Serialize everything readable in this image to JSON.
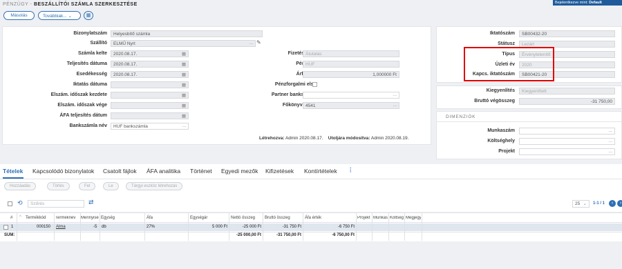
{
  "header": {
    "breadcrumb": "PÉNZÜGY",
    "title": "BESZÁLLÍTÓI SZÁMLA SZERKESZTÉSE",
    "login_text": "Bejelentkezve mint: ",
    "login_user": "Default"
  },
  "toolbar": {
    "copy": "Másolás",
    "more": "Továbbiak..."
  },
  "left": {
    "bizonylatszam": {
      "label": "Bizonylatszám",
      "value": "Helyesbítő számla"
    },
    "szallito": {
      "label": "Szállító",
      "value": "ELMŰ Nyrt"
    },
    "szamla_kelte": {
      "label": "Számla kelte",
      "value": "2020.08.17."
    },
    "teljesites": {
      "label": "Teljesítés dátuma",
      "value": "2020.08.17."
    },
    "esedekesseg": {
      "label": "Esedékesség",
      "value": "2020.08.17."
    },
    "iktatas": {
      "label": "Iktatás dátuma",
      "value": ""
    },
    "idoszak_kezdete": {
      "label": "Elszám. időszak kezdete",
      "value": ""
    },
    "idoszak_vege": {
      "label": "Elszám. időszak vége",
      "value": ""
    },
    "afa_teljesites": {
      "label": "ÁFA teljesítés dátum",
      "value": ""
    },
    "bankszamla": {
      "label": "Bankszámla név",
      "value": "HUF bankszámla"
    }
  },
  "mid": {
    "fizetesi_mod": {
      "label": "Fizetési mód",
      "value": "Átutalás"
    },
    "penznem": {
      "label": "Pénznem",
      "value": "HUF"
    },
    "arfolyam": {
      "label": "Árfolyam",
      "value": "1,000000 Ft"
    },
    "penzforgalmi": {
      "label": "Pénzforgalmi elsz."
    },
    "partner_bank": {
      "label": "Partner bankszámla",
      "value": ""
    },
    "fokonyvi": {
      "label": "Főkönyvi szám",
      "value": "4541"
    }
  },
  "footer": {
    "created_label": "Létrehozva:",
    "created_value": "Admin 2020.08.17.",
    "modified_label": "Utoljára módosítva:",
    "modified_value": "Admin 2020.08.19."
  },
  "right": {
    "iktatoszam": {
      "label": "Iktatószám",
      "value": "SB00432-20"
    },
    "statusz": {
      "label": "Státusz",
      "value": "Lezárt"
    },
    "tipus": {
      "label": "Típus",
      "value": "Érvénytelenítő"
    },
    "uzleti_ev": {
      "label": "Üzleti év",
      "value": "2020"
    },
    "kapcs": {
      "label": "Kapcs. iktatószám",
      "value": "SB00421-20"
    },
    "kiegyenlites": {
      "label": "Kiegyenlítés",
      "value": "Kiegyenlített"
    },
    "brutto": {
      "label": "Bruttó végösszeg",
      "value": "-31 750,00"
    },
    "dimenzio_title": "DIMENZIÓK",
    "munkaszam": {
      "label": "Munkaszám",
      "value": ""
    },
    "koltseghely": {
      "label": "Költséghely",
      "value": ""
    },
    "projekt": {
      "label": "Projekt",
      "value": ""
    },
    "highlight_color": "#e00000"
  },
  "tabs": [
    "Tételek",
    "Kapcsolódó bizonylatok",
    "Csatolt fájlok",
    "ÁFA analitika",
    "Történet",
    "Egyedi mezők",
    "Kifizetések",
    "Kontírtételek"
  ],
  "actions": [
    "Hozzáadás",
    "Törlés",
    "Fel",
    "Le",
    "Tárgyi eszköz létrehozás"
  ],
  "grid": {
    "filter_placeholder": "Szűrés",
    "page_size": "25",
    "page_info": "1-1 / 1",
    "headers": [
      "#",
      "Termékkód",
      "Terméknév",
      "Mennyiség",
      "Egység",
      "Áfa",
      "Egységár",
      "Nettó összeg",
      "Bruttó összeg",
      "Áfa érték",
      "Projekt",
      "Munkaszám",
      "Költséghely",
      "Megjegyzés"
    ],
    "row": {
      "num": "1",
      "kod": "000150",
      "nev": "Alma",
      "menny": "-5",
      "egyseg": "db",
      "afa": "27%",
      "egysegar": "5 000 Ft",
      "netto": "-25 000 Ft",
      "brutto": "-31 750 Ft",
      "afa_ertek": "-6 750 Ft"
    },
    "sum": {
      "label": "SUM:",
      "netto": "-25 000,00 Ft",
      "brutto": "-31 750,00 Ft",
      "afa_ertek": "-6 750,00 Ft"
    }
  },
  "colors": {
    "accent": "#2f6fb5",
    "header_bar": "#1f5a9b",
    "selected_row": "#dfe6ee"
  }
}
